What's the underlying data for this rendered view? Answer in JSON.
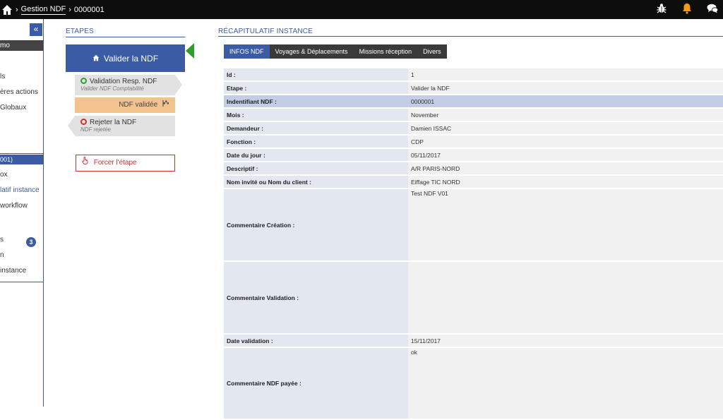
{
  "breadcrumb": {
    "section": "Gestion NDF",
    "current": "0000001"
  },
  "topbar_icons": [
    "bug-icon",
    "bell-icon",
    "chat-icon"
  ],
  "colors": {
    "brand": "#3b5ba5",
    "topbar": "#0d0d0d",
    "accent_green": "#2e9e2e",
    "danger": "#d32f2f",
    "validated": "#f2c38d"
  },
  "sidebar": {
    "items": [
      "mo",
      "",
      "ls",
      "ères actions",
      "Globaux"
    ],
    "group_head": "001)",
    "group_items": [
      "ox",
      "latif instance",
      "workflow",
      "",
      "s",
      "n",
      "instance"
    ],
    "badge": "3"
  },
  "etapes": {
    "title": "ETAPES",
    "current": "Valider la NDF",
    "next_label": "Validation Resp. NDF",
    "next_sub": "Valider NDF Comptabilité",
    "final_label": "NDF validée",
    "reject_label": "Rejeter la NDF",
    "reject_sub": "NDF rejetée",
    "force_label": "Forcer l'étape"
  },
  "recap": {
    "title": "RÉCAPITULATIF INSTANCE",
    "tabs": [
      "INFOS NDF",
      "Voyages & Déplacements",
      "Missions réception",
      "Divers"
    ],
    "rows": [
      {
        "label": "Id :",
        "value": "1"
      },
      {
        "label": "Etape :",
        "value": "Valider la NDF"
      },
      {
        "label": "Indentifiant NDF :",
        "value": "0000001"
      },
      {
        "label": "Mois :",
        "value": "November"
      },
      {
        "label": "Demandeur :",
        "value": "Damien ISSAC"
      },
      {
        "label": "Fonction :",
        "value": "CDP"
      },
      {
        "label": "Date du jour :",
        "value": "05/11/2017"
      },
      {
        "label": "Descriptif :",
        "value": "A/R PARIS-NORD"
      },
      {
        "label": "Nom invité ou Nom du client :",
        "value": "Eiffage TIC NORD"
      },
      {
        "label": "Commentaire Création :",
        "value": "Test NDF V01"
      },
      {
        "label": "Commentaire Validation :",
        "value": ""
      },
      {
        "label": "Date validation :",
        "value": "15/11/2017"
      },
      {
        "label": "Commentaire NDF payée :",
        "value": "ok"
      }
    ]
  }
}
